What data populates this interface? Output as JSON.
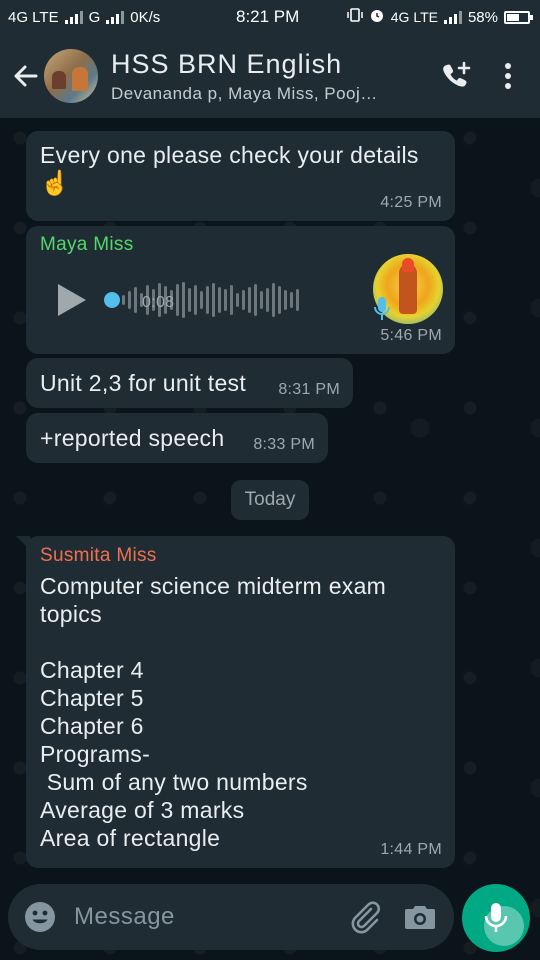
{
  "status_bar": {
    "network_left": "4G LTE",
    "network_mid": "G",
    "speed": "0K/s",
    "time": "8:21 PM",
    "network_right": "4G LTE",
    "battery": "58%",
    "battery_level": 0.58
  },
  "header": {
    "title": "HSS BRN English",
    "subtitle": "Devananda p, Maya Miss, Pooj…"
  },
  "messages": [
    {
      "text": "Every one please check your details",
      "emoji": "☝️",
      "time": "4:25 PM"
    },
    {
      "sender": "Maya Miss",
      "sender_color": "#53d769",
      "duration": "0:08",
      "time": "5:46 PM"
    },
    {
      "text": "Unit 2,3 for unit test",
      "time": "8:31 PM"
    },
    {
      "text": "+reported speech",
      "time": "8:33 PM"
    },
    {
      "sender": "Susmita Miss",
      "sender_color": "#f0704f",
      "body": "Computer science midterm exam\ntopics\n\nChapter 4\nChapter 5\nChapter 6\nPrograms-\n Sum of any two numbers\nAverage of 3 marks\nArea of rectangle",
      "time": "1:44 PM"
    }
  ],
  "date_divider": "Today",
  "composer": {
    "placeholder": "Message"
  },
  "colors": {
    "background": "#0b141a",
    "bubble": "#1f2c34",
    "accent": "#00a884",
    "audio_dot": "#53bdeb"
  }
}
